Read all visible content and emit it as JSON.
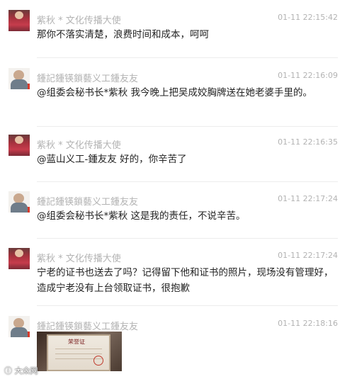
{
  "messages": [
    {
      "author": "紫秋 * 文化传播大使",
      "time": "01-11 22:15:42",
      "text": "那你不落实清楚，浪费时间和成本，呵呵"
    },
    {
      "author": "鍾記鍾锳鎖藝义工鍾友友",
      "time": "01-11 22:16:09",
      "text": "@组委会秘书长*紫秋 我今晚上把吴成姣胸牌送在她老婆手里的。"
    },
    {
      "author": "紫秋 * 文化传播大使",
      "time": "01-11 22:16:35",
      "text": "@蓝山义工-鍾友友 好的，你辛苦了"
    },
    {
      "author": "鍾記鍾锳鎖藝义工鍾友友",
      "time": "01-11 22:17:24",
      "text": "@组委会秘书长*紫秋 这是我的责任，不说辛苦。"
    },
    {
      "author": "紫秋 * 文化传播大使",
      "time": "01-11 22:17:24",
      "text": "宁老的证书也送去了吗？记得留下他和证书的照片，现场没有管理好，造成宁老没有上台领取证书，很抱歉"
    },
    {
      "author": "鍾記鍾锳鎖藝义工鍾友友",
      "time": "01-11 22:18:16",
      "text": ""
    }
  ],
  "photo": {
    "certificate_title": "荣誉证"
  },
  "watermark": "大众网"
}
